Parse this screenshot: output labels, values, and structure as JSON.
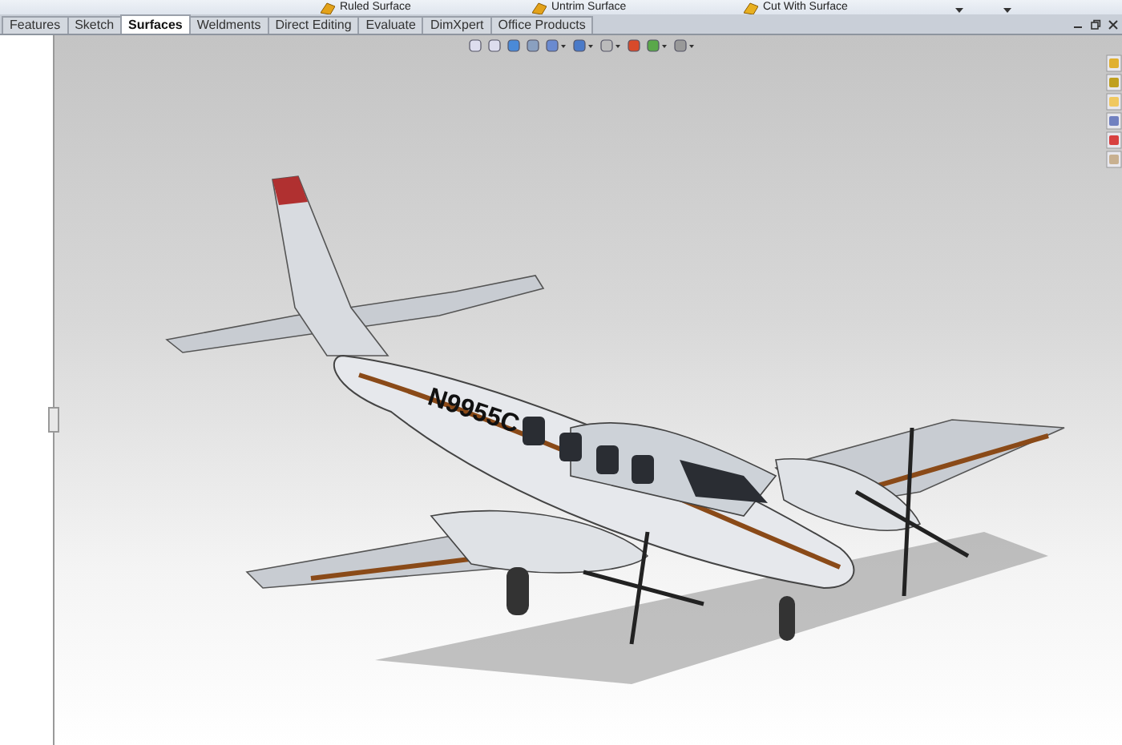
{
  "ribbon": {
    "commands": [
      {
        "label": "Ruled Surface"
      },
      {
        "label": "Untrim Surface"
      },
      {
        "label": "Cut With Surface"
      }
    ]
  },
  "tabs": [
    {
      "label": "Features",
      "selected": false
    },
    {
      "label": "Sketch",
      "selected": false
    },
    {
      "label": "Surfaces",
      "selected": true
    },
    {
      "label": "Weldments",
      "selected": false
    },
    {
      "label": "Direct Editing",
      "selected": false
    },
    {
      "label": "Evaluate",
      "selected": false
    },
    {
      "label": "DimXpert",
      "selected": false
    },
    {
      "label": "Office Products",
      "selected": false
    }
  ],
  "model": {
    "registration": "N9955C"
  }
}
